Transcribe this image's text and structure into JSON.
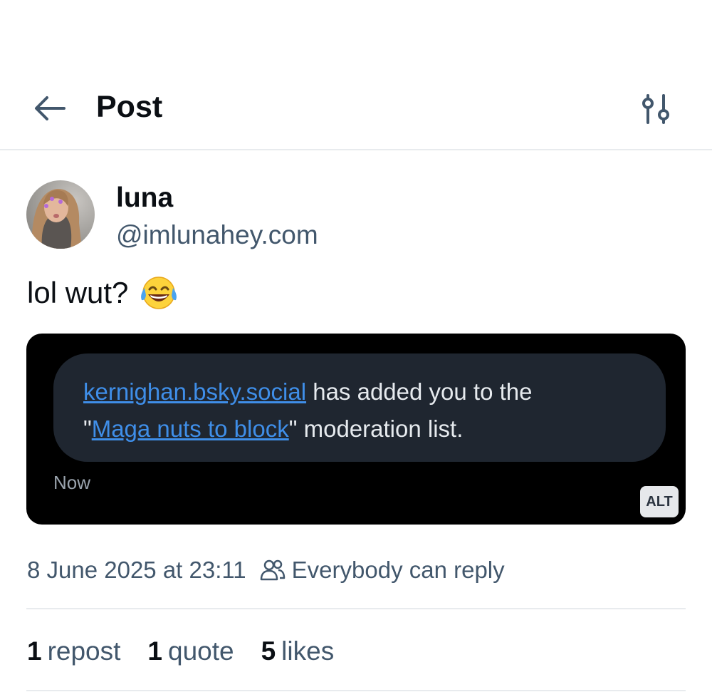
{
  "header": {
    "title": "Post",
    "back_icon": "arrow-left-icon",
    "filter_icon": "sliders-icon"
  },
  "post": {
    "author": {
      "display_name": "luna",
      "handle": "@imlunahey.com",
      "avatar": "avatar-photo"
    },
    "text": "lol wut?",
    "emoji": "face-with-tears-of-joy",
    "embed": {
      "link_user": "kernighan.bsky.social",
      "text_middle": " has added you to the",
      "quote_open": "\"",
      "link_list": "Maga nuts to block",
      "text_end": "\" moderation list.",
      "time": "Now",
      "alt_badge": "ALT"
    },
    "timestamp": "8 June 2025 at 23:11",
    "reply_icon": "people-icon",
    "reply_setting": "Everybody can reply",
    "stats": {
      "reposts_count": "1",
      "reposts_label": "repost",
      "quotes_count": "1",
      "quotes_label": "quote",
      "likes_count": "5",
      "likes_label": "likes"
    }
  },
  "colors": {
    "text_primary": "#0b0f14",
    "text_secondary": "#42576c",
    "link": "#3f8ee8",
    "embed_bg": "#000000",
    "bubble_bg": "#1f2630",
    "divider": "#e8ebee"
  }
}
